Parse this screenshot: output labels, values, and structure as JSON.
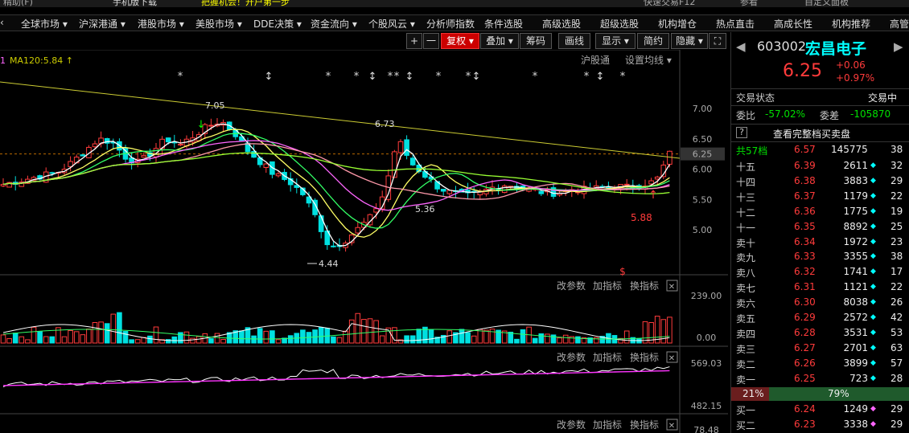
{
  "topbar": {
    "items": [
      "精助(F)",
      "手机版下载",
      "把握机会！开户第一步",
      "快速交易F12",
      "参看",
      "自定义面板"
    ]
  },
  "menu": [
    "全球市场 ▾",
    "沪深港通 ▾",
    "港股市场 ▾",
    "美股市场 ▾",
    "DDE决策 ▾",
    "资金流向 ▾",
    "个股风云 ▾",
    "分析师指数",
    "条件选股",
    "高级选股",
    "超级选股",
    "机构增仓",
    "热点直击",
    "高成长性",
    "机构推荐",
    "高管"
  ],
  "toolbar": {
    "plus": "+",
    "minus": "一",
    "fuquan": "复权 ▾",
    "diejia": "叠加 ▾",
    "chouma": "筹码",
    "huaxian": "画线",
    "xianshi": "显示 ▾",
    "jianyue": "简约",
    "yincang": "隐藏 ▾",
    "full": "⛶",
    "close": "✕"
  },
  "chart": {
    "ma_label": "MA120:5.84 ↑",
    "ma_label_prefix": "1",
    "hugutong": "沪股通",
    "set_ma": "设置均线 ▾",
    "price_ticks": [
      "7.00",
      "6.50",
      "6.25",
      "6.00",
      "5.50",
      "5.00"
    ],
    "annotations": {
      "high1": "7.05",
      "high2": "6.73",
      "low1": "4.44",
      "low2": "5.36",
      "mark": "5.88"
    },
    "vol_ticks": [
      "239.00",
      "0.00"
    ],
    "ind_ticks": [
      "569.03",
      "482.15",
      "78.48"
    ],
    "panel_btns": {
      "param": "改参数",
      "add": "加指标",
      "switch": "换指标",
      "close": "✕"
    }
  },
  "quote": {
    "code": "603002",
    "name": "宏昌电子",
    "price": "6.25",
    "change": "+0.06",
    "pct": "+0.97%",
    "state_label": "交易状态",
    "state_value": "交易中",
    "weibi_label": "委比",
    "weibi": "-57.02%",
    "weicha_label": "委差",
    "weicha": "-105870",
    "full_book": "查看完整档买卖盘",
    "q_mark": "?",
    "total": {
      "label": "共57档",
      "price": "6.57",
      "vol": "145775",
      "n": "38"
    },
    "asks": [
      {
        "label": "十五",
        "price": "6.39",
        "vol": "2611",
        "n": "32"
      },
      {
        "label": "十四",
        "price": "6.38",
        "vol": "3883",
        "n": "29"
      },
      {
        "label": "十三",
        "price": "6.37",
        "vol": "1179",
        "n": "22"
      },
      {
        "label": "十二",
        "price": "6.36",
        "vol": "1775",
        "n": "19"
      },
      {
        "label": "十一",
        "price": "6.35",
        "vol": "8892",
        "n": "25"
      },
      {
        "label": "卖十",
        "price": "6.34",
        "vol": "1972",
        "n": "23"
      },
      {
        "label": "卖九",
        "price": "6.33",
        "vol": "3355",
        "n": "38"
      },
      {
        "label": "卖八",
        "price": "6.32",
        "vol": "1741",
        "n": "17"
      },
      {
        "label": "卖七",
        "price": "6.31",
        "vol": "1121",
        "n": "22"
      },
      {
        "label": "卖六",
        "price": "6.30",
        "vol": "8038",
        "n": "26"
      },
      {
        "label": "卖五",
        "price": "6.29",
        "vol": "2572",
        "n": "42"
      },
      {
        "label": "卖四",
        "price": "6.28",
        "vol": "3531",
        "n": "53"
      },
      {
        "label": "卖三",
        "price": "6.27",
        "vol": "2701",
        "n": "63"
      },
      {
        "label": "卖二",
        "price": "6.26",
        "vol": "3899",
        "n": "57"
      },
      {
        "label": "卖一",
        "price": "6.25",
        "vol": "723",
        "n": "28"
      }
    ],
    "ratio": {
      "sell": "21%",
      "buy": "79%",
      "sell_frac": 0.21
    },
    "bids": [
      {
        "label": "买一",
        "price": "6.24",
        "vol": "1249",
        "n": "29"
      },
      {
        "label": "买二",
        "price": "6.23",
        "vol": "3338",
        "n": "29"
      }
    ],
    "colors": {
      "red": "#ff3b3b",
      "green": "#00e000",
      "cyan": "#00ffff",
      "pink": "#ff66ff"
    }
  }
}
